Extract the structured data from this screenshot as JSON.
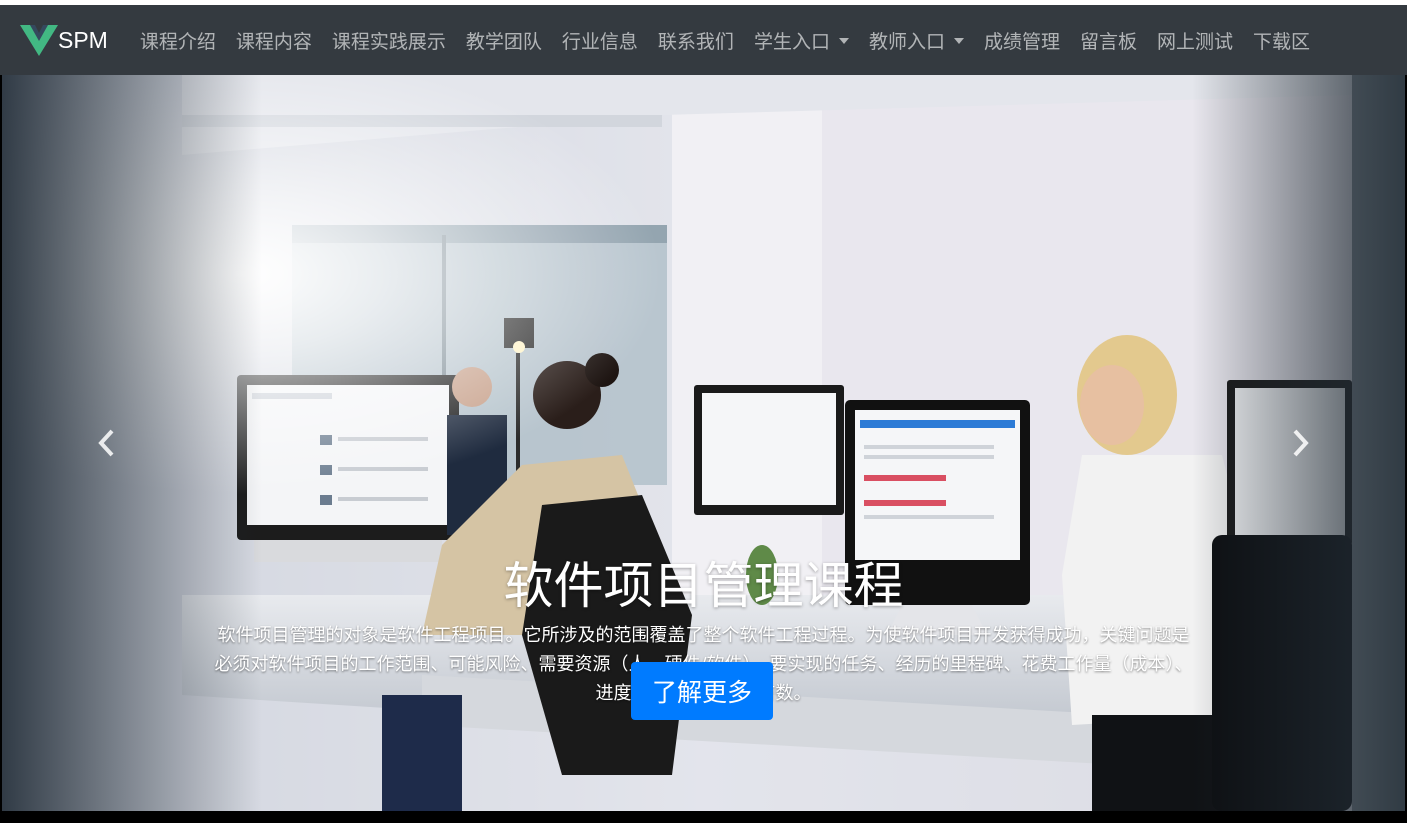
{
  "brand": {
    "logo_letter": "V",
    "name": "SPM"
  },
  "nav": {
    "items": [
      {
        "label": "课程介绍"
      },
      {
        "label": "课程内容"
      },
      {
        "label": "课程实践展示"
      },
      {
        "label": "教学团队"
      },
      {
        "label": "行业信息"
      },
      {
        "label": "联系我们"
      },
      {
        "label": "学生入口",
        "dropdown": true
      },
      {
        "label": "教师入口",
        "dropdown": true
      },
      {
        "label": "成绩管理"
      },
      {
        "label": "留言板"
      },
      {
        "label": "网上测试"
      },
      {
        "label": "下载区"
      }
    ]
  },
  "carousel": {
    "title": "软件项目管理课程",
    "description": "软件项目管理的对象是软件工程项目。它所涉及的范围覆盖了整个软件工程过程。为使软件项目开发获得成功，关键问题是必须对软件项目的工作范围、可能风险、需要资源（人、硬件/软件）、要实现的任务、经历的里程碑、花费工作量（成本）、进度安排等做到心中有数。",
    "button_label": "了解更多",
    "prev_icon": "chevron-left-icon",
    "next_icon": "chevron-right-icon"
  },
  "colors": {
    "navbar_bg": "#343a40",
    "brand_logo": "#42b883",
    "button_primary": "#007bff"
  }
}
